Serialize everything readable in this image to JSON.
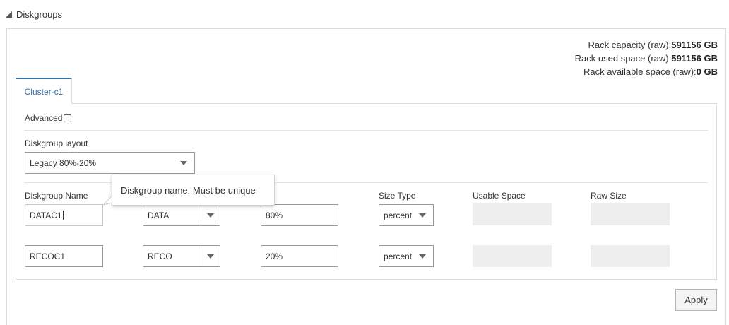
{
  "section": {
    "title": "Diskgroups"
  },
  "rack": {
    "capacity_label": "Rack capacity (raw):",
    "capacity_value": "591156 GB",
    "used_label": "Rack used space (raw):",
    "used_value": "591156 GB",
    "available_label": "Rack available space (raw):",
    "available_value": "0 GB"
  },
  "tabs": [
    {
      "label": "Cluster-c1"
    }
  ],
  "advanced_label": "Advanced",
  "layout": {
    "label": "Diskgroup layout",
    "value": "Legacy 80%-20%"
  },
  "columns": {
    "name": "Diskgroup Name",
    "size_type": "Size Type",
    "usable_space": "Usable Space",
    "raw_size": "Raw Size"
  },
  "rows": [
    {
      "name": "DATAC1",
      "type": "DATA",
      "size": "80%",
      "size_type": "percent"
    },
    {
      "name": "RECOC1",
      "type": "RECO",
      "size": "20%",
      "size_type": "percent"
    }
  ],
  "tooltip": "Diskgroup name. Must be unique",
  "apply_label": "Apply"
}
